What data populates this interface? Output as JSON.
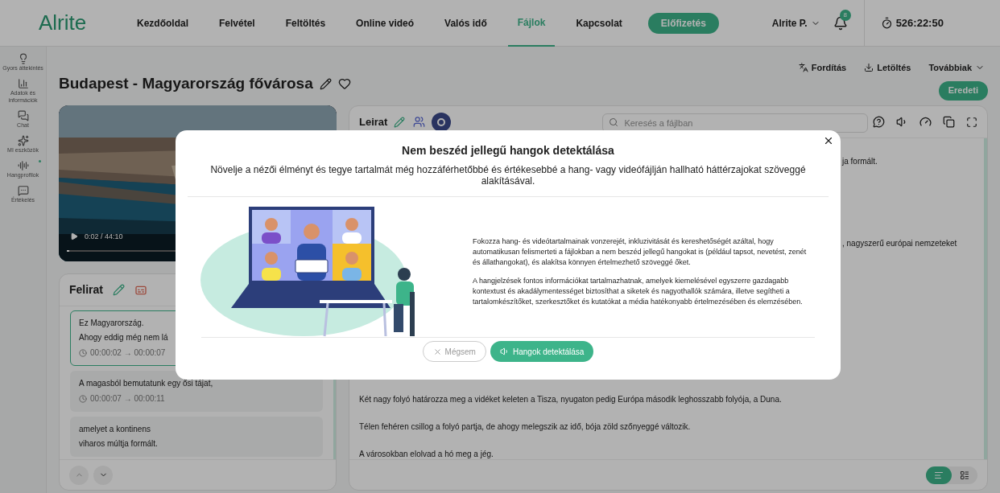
{
  "brand": {
    "name": "Alrite"
  },
  "nav": [
    {
      "label": "Kezdőoldal",
      "selected": false
    },
    {
      "label": "Felvétel",
      "selected": false
    },
    {
      "label": "Feltöltés",
      "selected": false
    },
    {
      "label": "Online videó",
      "selected": false
    },
    {
      "label": "Valós idő",
      "selected": false
    },
    {
      "label": "Fájlok",
      "selected": true
    },
    {
      "label": "Kapcsolat",
      "selected": false
    }
  ],
  "subscribe_button": "Előfizetés",
  "user": {
    "name": "Alrite P.",
    "notifications": "8",
    "timer": "526:22:50"
  },
  "sidebar": [
    {
      "label": "Gyors áttekintés",
      "dot": false
    },
    {
      "label": "Adatok és információk",
      "dot": false
    },
    {
      "label": "Chat",
      "dot": false
    },
    {
      "label": "MI eszközök",
      "dot": false
    },
    {
      "label": "Hangprofilok",
      "dot": true
    },
    {
      "label": "Értékelés",
      "dot": false
    }
  ],
  "file_title": "Budapest - Magyarország fővárosa",
  "actions": [
    {
      "label": "Fordítás",
      "kind": "translate"
    },
    {
      "label": "Letöltés",
      "kind": "download"
    },
    {
      "label": "Továbbiak",
      "kind": "menu"
    }
  ],
  "original_button": "Eredeti",
  "video": {
    "time": "0:02 / 44:10",
    "level": 0.01
  },
  "subtitles": {
    "title": "Felirat",
    "items": [
      {
        "lines": [
          "Ez Magyarország.",
          "Ahogy eddig még nem lá"
        ],
        "time": "00:00:02 → 00:00:07",
        "selected": true
      },
      {
        "lines": [
          "A magasból bemutatunk egy ősi tájat,"
        ],
        "time": "00:00:07 → 00:00:11",
        "selected": false
      },
      {
        "lines": [
          "amelyet a kontinens",
          "viharos múltja formált."
        ],
        "selected": false
      }
    ]
  },
  "transcript": {
    "title": "Leirat",
    "search": {
      "placeholder": "Keresés a fájlban"
    },
    "paragraphs": [
      {
        "text": "ja formált.",
        "kind": "fragment"
      },
      {
        "text": ", nagyszerű európai nemzeteket",
        "kind": "fragment"
      },
      {
        "text": "Két nagy folyó határozza meg a vidéket keleten a Tisza, nyugaton pedig Európa második leghosszabb folyója, a Duna.",
        "kind": "full"
      },
      {
        "text": "Télen fehéren csillog a folyó partja, de ahogy melegszik az idő, bója zöld szőnyeggé változik.",
        "kind": "full"
      },
      {
        "text": "A városokban elolvad a hó meg a jég.",
        "kind": "full"
      }
    ],
    "views": [
      {
        "selected": true
      },
      {
        "selected": false
      }
    ]
  },
  "modal": {
    "title": "Nem beszéd jellegű hangok detektálása",
    "subtitle": "Növelje a nézői élményt és tegye tartalmát még hozzáférhetőbbé és értékesebbé a hang- vagy videófájlján hallható háttérzajokat szöveggé alakításával.",
    "paragraphs": [
      "Fokozza hang- és videótartalmainak vonzerejét, inkluzivitását és kereshetőségét azáltal, hogy automatikusan felismerteti a fájlokban a nem beszéd jellegű hangokat is (például tapsot, nevetést, zenét és állathangokat), és alakítsa könnyen értelmezhető szöveggé őket.",
      "A hangjelzések fontos információkat tartalmazhatnak, amelyek kiemelésével egyszerre gazdagabb kontextust és akadálymentességet biztosíthat a siketek és nagyothallók számára, illetve segítheti a tartalomkészítőket, szerkesztőket és kutatókat a média hatékonyabb értelmezésében és elemzésében."
    ],
    "cancel": "Mégsem",
    "confirm": "Hangok detektálása"
  }
}
